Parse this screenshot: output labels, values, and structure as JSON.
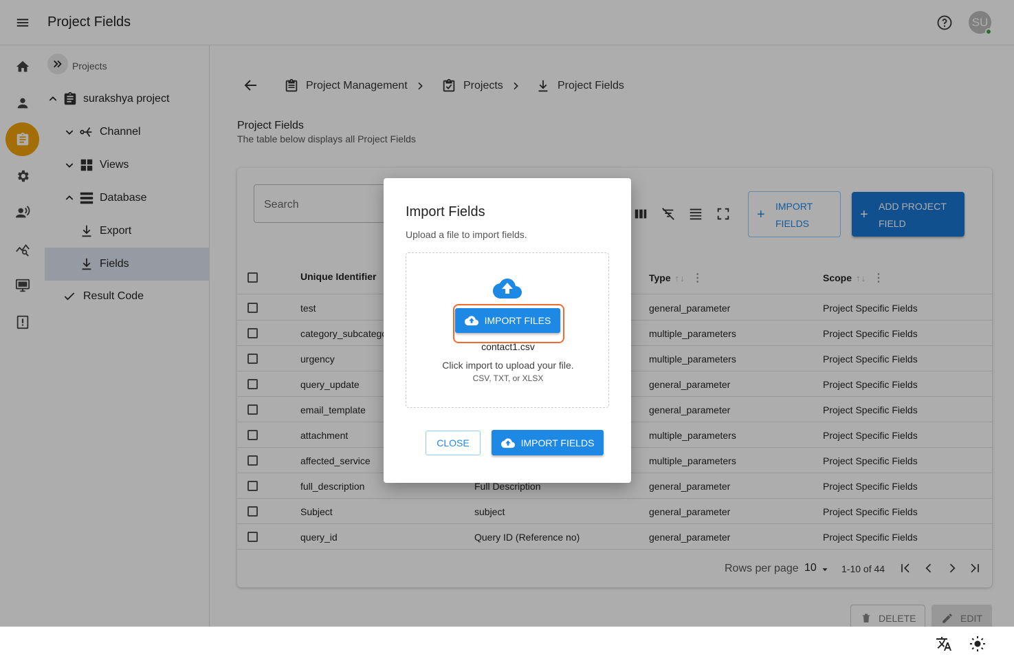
{
  "header": {
    "title": "Project Fields",
    "avatar_initials": "SU"
  },
  "colors": {
    "accent": "#1976d2",
    "rail_active": "#f0a30a",
    "highlight": "#f26b2e",
    "online": "#43a047"
  },
  "rail": {
    "icons": [
      "home-icon",
      "person-icon",
      "clipboard-icon",
      "gear-icon",
      "voice-icon",
      "analytics-icon",
      "monitor-icon",
      "report-icon"
    ]
  },
  "tree": {
    "root_label": "Projects",
    "items": [
      {
        "label": "surakshya project"
      },
      {
        "label": "Channel"
      },
      {
        "label": "Views"
      },
      {
        "label": "Database"
      },
      {
        "label": "Export"
      },
      {
        "label": "Fields"
      },
      {
        "label": "Result Code"
      }
    ]
  },
  "breadcrumb": [
    "Project Management",
    "Projects",
    "Project Fields"
  ],
  "page": {
    "title": "Project Fields",
    "subtitle": "The table below displays all Project Fields"
  },
  "toolbar": {
    "search_placeholder": "Search",
    "import_l1": "IMPORT",
    "import_l2": "FIELDS",
    "add_l1": "ADD PROJECT",
    "add_l2": "FIELD"
  },
  "table": {
    "columns": [
      "Unique Identifier",
      "Type",
      "Scope"
    ],
    "rows": [
      {
        "id": "test",
        "label": "",
        "type": "general_parameter",
        "scope": "Project Specific Fields"
      },
      {
        "id": "category_subcatego",
        "label": "",
        "type": "multiple_parameters",
        "scope": "Project Specific Fields"
      },
      {
        "id": "urgency",
        "label": "",
        "type": "multiple_parameters",
        "scope": "Project Specific Fields"
      },
      {
        "id": "query_update",
        "label": "",
        "type": "general_parameter",
        "scope": "Project Specific Fields"
      },
      {
        "id": "email_template",
        "label": "",
        "type": "general_parameter",
        "scope": "Project Specific Fields"
      },
      {
        "id": "attachment",
        "label": "",
        "type": "multiple_parameters",
        "scope": "Project Specific Fields"
      },
      {
        "id": "affected_service",
        "label": "",
        "type": "multiple_parameters",
        "scope": "Project Specific Fields"
      },
      {
        "id": "full_description",
        "label": "Full Description",
        "type": "general_parameter",
        "scope": "Project Specific Fields"
      },
      {
        "id": "Subject",
        "label": "subject",
        "type": "general_parameter",
        "scope": "Project Specific Fields"
      },
      {
        "id": "query_id",
        "label": "Query ID (Reference no)",
        "type": "general_parameter",
        "scope": "Project Specific Fields"
      }
    ]
  },
  "pager": {
    "rows_per_page_label": "Rows per page",
    "rows_per_page": "10",
    "range": "1-10 of 44"
  },
  "actions": {
    "delete": "DELETE",
    "edit": "EDIT"
  },
  "modal": {
    "title": "Import Fields",
    "subtitle": "Upload a file to import fields.",
    "import_files": "IMPORT FILES",
    "file_name": "contact1.csv",
    "hint": "Click import to upload your file.",
    "formats": "CSV, TXT, or XLSX",
    "close": "CLOSE",
    "import_fields": "IMPORT FIELDS"
  }
}
